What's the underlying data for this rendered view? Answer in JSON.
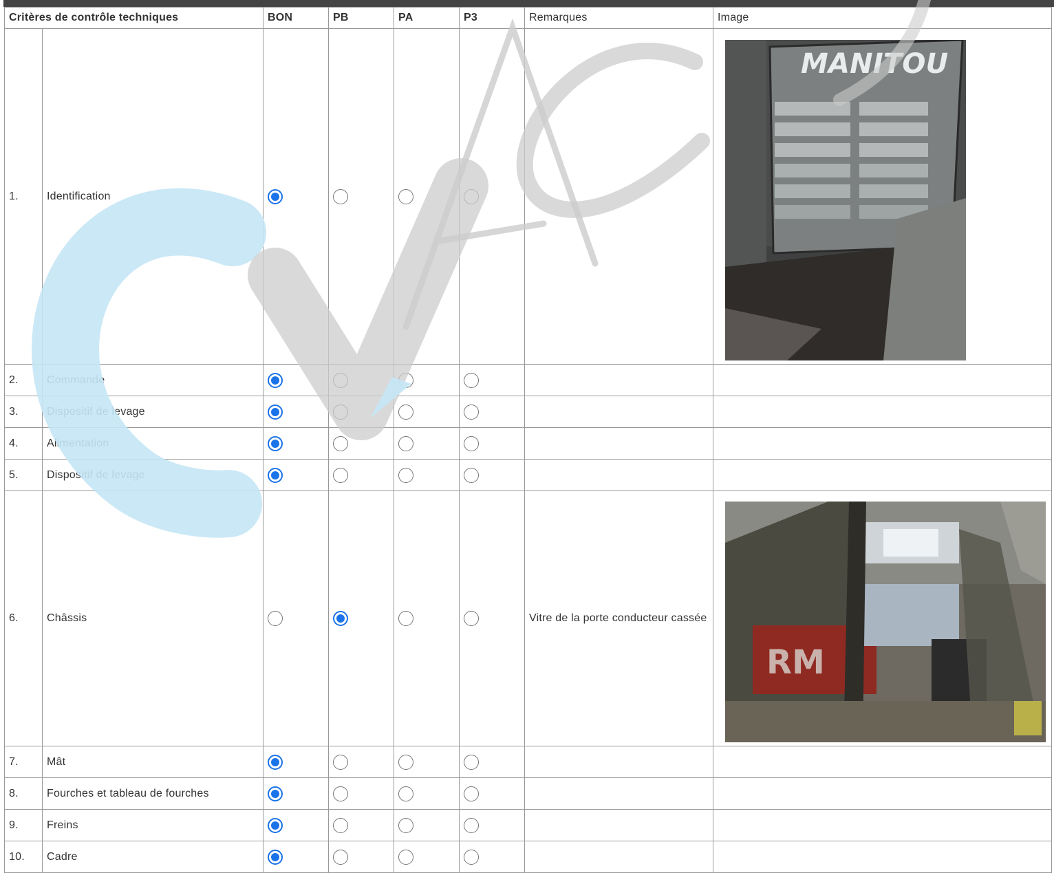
{
  "header": {
    "criteria": "Critères de contrôle techniques",
    "bon": "BON",
    "pb": "PB",
    "pa": "PA",
    "p3": "P3",
    "remarks": "Remarques",
    "image": "Image"
  },
  "rows": [
    {
      "num": "1.",
      "label": "Identification",
      "selected": "BON",
      "remark": "",
      "has_image": true
    },
    {
      "num": "2.",
      "label": "Commande",
      "selected": "BON",
      "remark": "",
      "has_image": false
    },
    {
      "num": "3.",
      "label": "Dispositif de levage",
      "selected": "BON",
      "remark": "",
      "has_image": false
    },
    {
      "num": "4.",
      "label": "Alimentation",
      "selected": "BON",
      "remark": "",
      "has_image": false
    },
    {
      "num": "5.",
      "label": "Dispositif de levage",
      "selected": "BON",
      "remark": "",
      "has_image": false
    },
    {
      "num": "6.",
      "label": "Châssis",
      "selected": "PB",
      "remark": "Vitre de la porte conducteur cassée",
      "has_image": true
    },
    {
      "num": "7.",
      "label": "Mât",
      "selected": "BON",
      "remark": "",
      "has_image": false
    },
    {
      "num": "8.",
      "label": "Fourches et tableau de fourches",
      "selected": "BON",
      "remark": "",
      "has_image": false
    },
    {
      "num": "9.",
      "label": "Freins",
      "selected": "BON",
      "remark": "",
      "has_image": false
    },
    {
      "num": "10.",
      "label": "Cadre",
      "selected": "BON",
      "remark": "",
      "has_image": false
    }
  ],
  "images": {
    "plate_brand": "MANITOU",
    "plate_icon": "id-plate-photo-icon",
    "cab_icon": "broken-cab-window-photo-icon"
  },
  "colors": {
    "radio_checked": "#1a73e8",
    "grid_border": "#999999",
    "watermark_blue": "#c5e6f5",
    "watermark_gray": "#cccccc"
  }
}
